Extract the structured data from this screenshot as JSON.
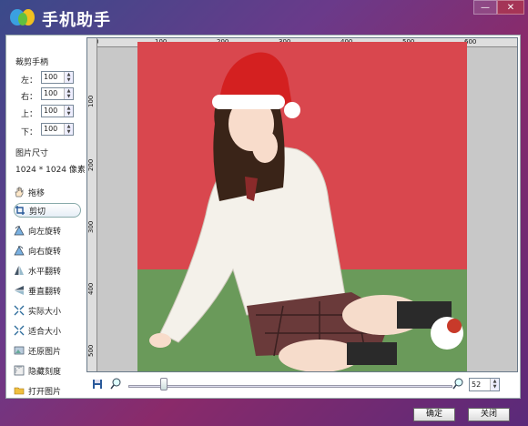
{
  "app": {
    "title": "手机助手"
  },
  "window_controls": {
    "minimize": "—",
    "close": "✕"
  },
  "crop_handles": {
    "heading": "裁剪手柄",
    "fields": [
      {
        "label": "左：",
        "value": "100"
      },
      {
        "label": "右：",
        "value": "100"
      },
      {
        "label": "上：",
        "value": "100"
      },
      {
        "label": "下：",
        "value": "100"
      }
    ]
  },
  "image_size": {
    "heading": "图片尺寸",
    "value": "1024 * 1024 像素"
  },
  "tools": [
    {
      "label": "拖移",
      "icon": "hand-icon",
      "active": false
    },
    {
      "label": "剪切",
      "icon": "crop-icon",
      "active": true
    },
    {
      "label": "向左旋转",
      "icon": "rotate-left-icon",
      "active": false
    },
    {
      "label": "向右旋转",
      "icon": "rotate-right-icon",
      "active": false
    },
    {
      "label": "水平翻转",
      "icon": "flip-horizontal-icon",
      "active": false
    },
    {
      "label": "垂直翻转",
      "icon": "flip-vertical-icon",
      "active": false
    },
    {
      "label": "实际大小",
      "icon": "actual-size-icon",
      "active": false
    },
    {
      "label": "适合大小",
      "icon": "fit-size-icon",
      "active": false
    },
    {
      "label": "还原图片",
      "icon": "restore-icon",
      "active": false
    },
    {
      "label": "隐藏刻度",
      "icon": "hide-ruler-icon",
      "active": false
    },
    {
      "label": "打开图片",
      "icon": "folder-open-icon",
      "active": false
    }
  ],
  "ruler": {
    "top_ticks": [
      "0",
      "100",
      "200",
      "300",
      "400",
      "500",
      "600"
    ],
    "left_ticks": [
      "100",
      "200",
      "300",
      "400",
      "500"
    ]
  },
  "zoom": {
    "value": "52",
    "fraction": 0.1
  },
  "footer": {
    "ok_label": "确定",
    "close_label": "关闭"
  },
  "colors": {
    "accent": "#5a3a8a",
    "photo_background": "#d9474e",
    "floor": "#6a9a5a"
  }
}
